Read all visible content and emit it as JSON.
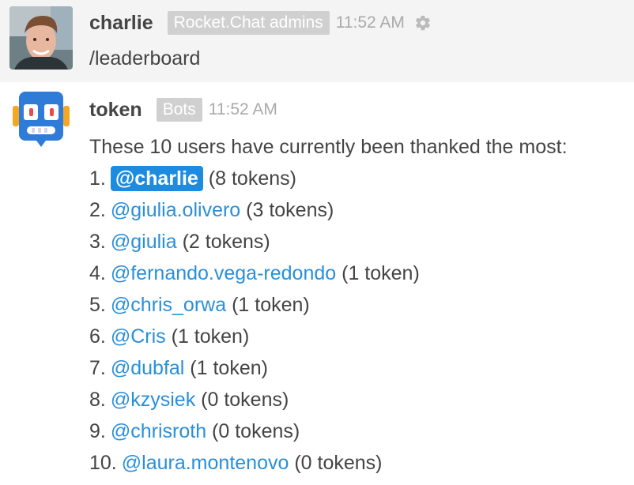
{
  "user_message": {
    "username": "charlie",
    "role": "Rocket.Chat admins",
    "time": "11:52 AM",
    "text": "/leaderboard",
    "actions_icon": "gear-icon"
  },
  "bot_message": {
    "username": "token",
    "role": "Bots",
    "time": "11:52 AM",
    "intro": "These 10 users have currently been thanked the most:",
    "leaderboard": [
      {
        "num": "1.",
        "mention": "@charlie",
        "count": "(8 tokens)",
        "self": true
      },
      {
        "num": "2.",
        "mention": "@giulia.olivero",
        "count": "(3 tokens)",
        "self": false
      },
      {
        "num": "3.",
        "mention": "@giulia",
        "count": "(2 tokens)",
        "self": false
      },
      {
        "num": "4.",
        "mention": "@fernando.vega-redondo",
        "count": "(1 token)",
        "self": false
      },
      {
        "num": "5.",
        "mention": "@chris_orwa",
        "count": "(1 token)",
        "self": false
      },
      {
        "num": "6.",
        "mention": "@Cris",
        "count": "(1 token)",
        "self": false
      },
      {
        "num": "7.",
        "mention": "@dubfal",
        "count": "(1 token)",
        "self": false
      },
      {
        "num": "8.",
        "mention": "@kzysiek",
        "count": "(0 tokens)",
        "self": false
      },
      {
        "num": "9.",
        "mention": "@chrisroth",
        "count": "(0 tokens)",
        "self": false
      },
      {
        "num": "10.",
        "mention": "@laura.montenovo",
        "count": "(0 tokens)",
        "self": false
      }
    ]
  },
  "colors": {
    "mention": "#2a8fd8",
    "mention_self_bg": "#1d8ce0",
    "tag_bg": "#d0d0d0",
    "user_msg_bg": "#f4f4f4"
  }
}
